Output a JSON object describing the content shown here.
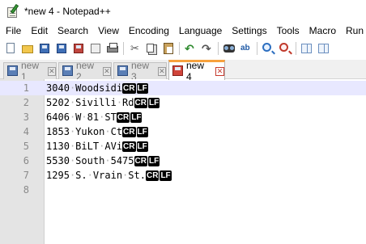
{
  "window": {
    "title": "*new 4 - Notepad++"
  },
  "menu": [
    "File",
    "Edit",
    "Search",
    "View",
    "Encoding",
    "Language",
    "Settings",
    "Tools",
    "Macro",
    "Run"
  ],
  "toolbar": {
    "buttons": [
      "new-file",
      "open-file",
      "save",
      "save-all",
      "close",
      "close-all",
      "print",
      "cut",
      "copy",
      "paste",
      "undo",
      "redo",
      "find",
      "replace",
      "zoom-in",
      "zoom-out",
      "sync-scroll",
      "word-wrap"
    ]
  },
  "tabs": [
    {
      "label": "new 1",
      "active": false
    },
    {
      "label": "new 2",
      "active": false
    },
    {
      "label": "new 3",
      "active": false
    },
    {
      "label": "new 4",
      "active": true
    }
  ],
  "editor": {
    "current_line": 1,
    "lines": [
      {
        "num": "1",
        "text": "3040 Woodsidi",
        "eol": [
          "CR",
          "LF"
        ]
      },
      {
        "num": "2",
        "text": "5202 Sivilli Rd",
        "eol": [
          "CR",
          "LF"
        ]
      },
      {
        "num": "3",
        "text": "6406 W 81 ST",
        "eol": [
          "CR",
          "LF"
        ]
      },
      {
        "num": "4",
        "text": "1853 Yukon Ct",
        "eol": [
          "CR",
          "LF"
        ]
      },
      {
        "num": "5",
        "text": "1130 BiLT AVi",
        "eol": [
          "CR",
          "LF"
        ]
      },
      {
        "num": "6",
        "text": "5530 South 5475",
        "eol": [
          "CR",
          "LF"
        ]
      },
      {
        "num": "7",
        "text": "1295 S. Vrain St.",
        "eol": [
          "CR",
          "LF"
        ]
      },
      {
        "num": "8",
        "text": "",
        "eol": []
      }
    ]
  }
}
